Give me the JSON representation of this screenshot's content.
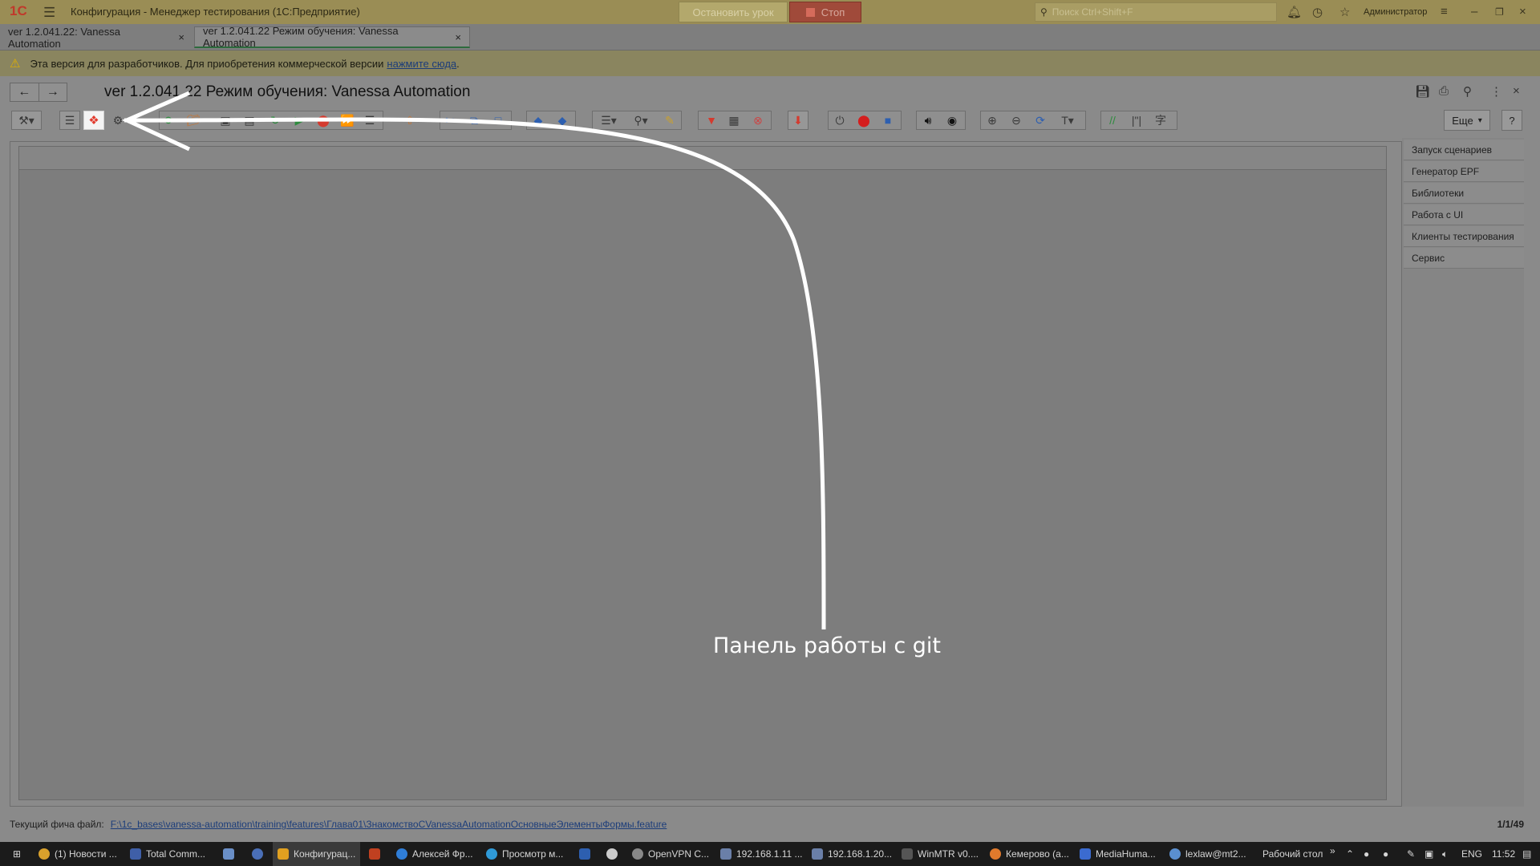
{
  "titlebar": {
    "logo": "1С",
    "title": "Конфигурация  - Менеджер тестирования (1С:Предприятие)",
    "lesson_stop": "Остановить урок",
    "stop": "Стоп",
    "search_placeholder": "Поиск Ctrl+Shift+F",
    "user": "Администратор"
  },
  "tabs": [
    {
      "label": "ver 1.2.041.22: Vanessa Automation"
    },
    {
      "label": "ver 1.2.041.22 Режим обучения: Vanessa Automation"
    }
  ],
  "warning": {
    "text": "Эта версия для разработчиков. Для приобретения коммерческой версии",
    "link": "нажмите сюда",
    "tail": "."
  },
  "page": {
    "title": "ver 1.2.041.22 Режим обучения: Vanessa Automation"
  },
  "toolbar": {
    "more_label": "Еще",
    "help_label": "?"
  },
  "right_panel": {
    "items": [
      "Запуск сценариев",
      "Генератор EPF",
      "Библиотеки",
      "Работа с UI",
      "Клиенты тестирования",
      "Сервис"
    ]
  },
  "annotation": {
    "text": "Панель работы с git"
  },
  "status": {
    "label": "Текущий фича файл:",
    "path": "F:\\1c_bases\\vanessa-automation\\training\\features\\Глава01\\ЗнакомствоСVanessaAutomationОсновныеЭлементыФормы.feature",
    "count": "1/1/49"
  },
  "taskbar": {
    "items": [
      "(1) Новости ...",
      "Total Comm...",
      "Конфигурац...",
      "Алексей Фр...",
      "Просмотр м...",
      "OpenVPN C...",
      "192.168.1.11 ...",
      "192.168.1.20...",
      "WinMTR v0....",
      "Кемерово (а...",
      "MediaHuma...",
      "lexlaw@mt2..."
    ],
    "desktop": "Рабочий стол",
    "lang": "ENG",
    "time": "11:52"
  },
  "colors": {
    "titlebar": "#9a8d55",
    "warning_bar": "#8a855f",
    "overlay": "#8a8a8a",
    "git_icon": "#e23b2e",
    "annotation": "#ffffff"
  }
}
